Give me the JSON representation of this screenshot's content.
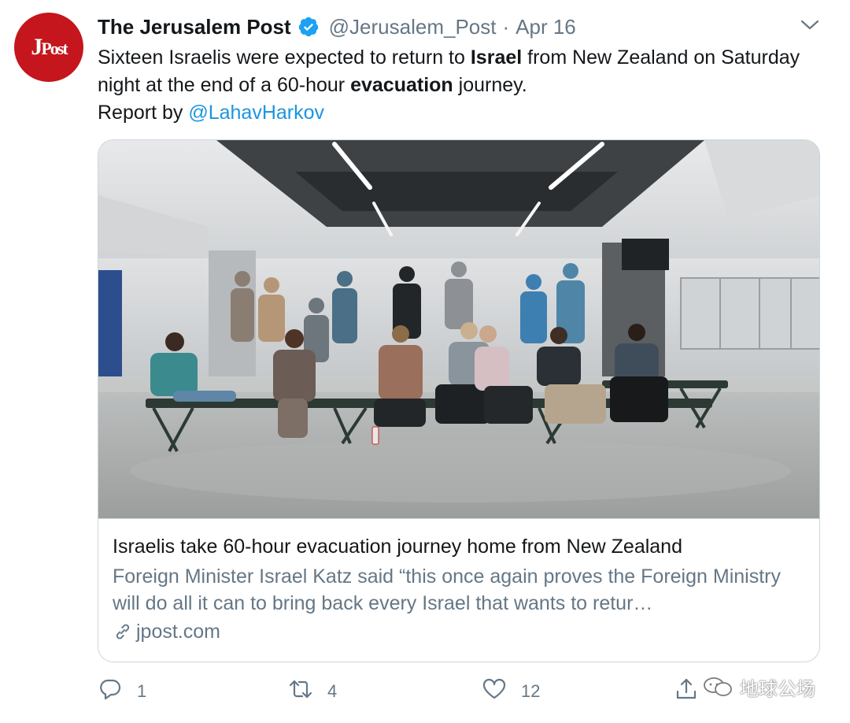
{
  "tweet": {
    "author": {
      "name": "The Jerusalem Post",
      "handle": "@Jerusalem_Post",
      "avatar_text": "JPost"
    },
    "date": "Apr 16",
    "separator": "·",
    "text": {
      "part1": "Sixteen Israelis were expected to return to ",
      "bold1": "Israel",
      "part2": " from New Zealand on Saturday night at the end of a 60-hour ",
      "bold2": "evacuation",
      "part3": " journey.",
      "report_prefix": "Report by ",
      "mention": "@LahavHarkov"
    },
    "card": {
      "title": "Israelis take 60-hour evacuation journey home from New Zealand",
      "description": "Foreign Minister Israel Katz said “this once again proves the Foreign Ministry will do all it can to bring back every Israel that wants to retur…",
      "domain": "jpost.com"
    },
    "actions": {
      "replies": "1",
      "retweets": "4",
      "likes": "12"
    }
  },
  "watermark": {
    "text": "地球公场"
  },
  "colors": {
    "link_blue": "#1b95e0",
    "verified_blue": "#1da1f2",
    "secondary_text": "#657786",
    "border": "#ccd6dd",
    "brand_red": "#c4161c"
  },
  "icons": {
    "verified": "verified-badge-icon",
    "caret": "chevron-down-icon",
    "reply": "reply-icon",
    "retweet": "retweet-icon",
    "like": "heart-icon",
    "share": "share-icon",
    "link": "link-icon"
  }
}
